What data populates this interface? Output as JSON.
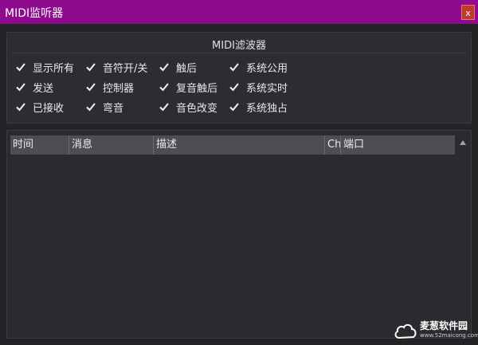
{
  "window": {
    "title": "MIDI监听器",
    "close_label": "x"
  },
  "filter": {
    "title": "MIDI滤波器",
    "options": [
      {
        "label": "显示所有",
        "checked": true
      },
      {
        "label": "音符开/关",
        "checked": true
      },
      {
        "label": "触后",
        "checked": true
      },
      {
        "label": "系统公用",
        "checked": true
      },
      {
        "label": "发送",
        "checked": true
      },
      {
        "label": "控制器",
        "checked": true
      },
      {
        "label": "复音触后",
        "checked": true
      },
      {
        "label": "系统实时",
        "checked": true
      },
      {
        "label": "已接收",
        "checked": true
      },
      {
        "label": "弯音",
        "checked": true
      },
      {
        "label": "音色改变",
        "checked": true
      },
      {
        "label": "系统独占",
        "checked": true
      }
    ]
  },
  "table": {
    "columns": [
      {
        "label": "时间"
      },
      {
        "label": "消息"
      },
      {
        "label": "描述"
      },
      {
        "label": "Ch"
      },
      {
        "label": "端口"
      }
    ],
    "rows": []
  },
  "watermark": {
    "brand": "麦葱软件园",
    "url": "www.52maicong.com"
  },
  "colors": {
    "titlebar": "#8e0b8e",
    "close_button": "#c0392b",
    "background": "#232426",
    "header": "#4d4e51"
  }
}
